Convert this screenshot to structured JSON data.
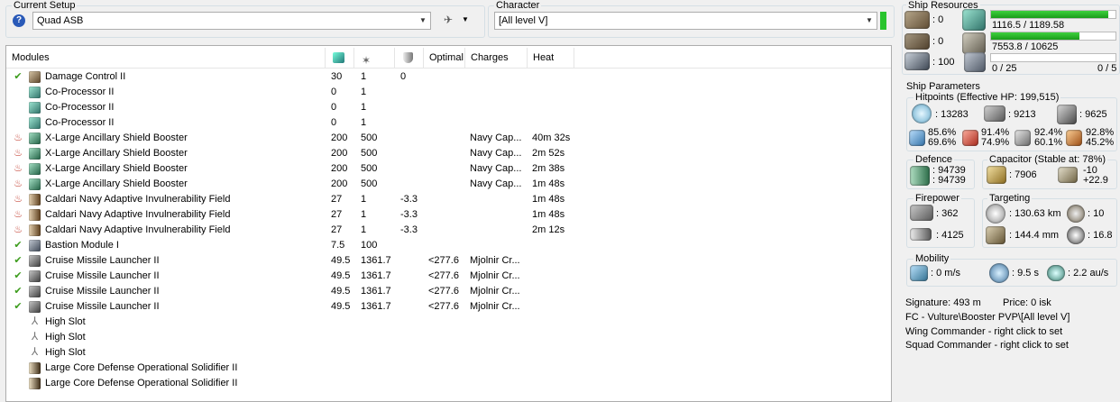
{
  "setup": {
    "group_label": "Current Setup",
    "selected": "Quad ASB"
  },
  "character": {
    "group_label": "Character",
    "selected": "[All level V]"
  },
  "modules_table": {
    "headers": {
      "modules": "Modules",
      "optimal": "Optimal",
      "charges": "Charges",
      "heat": "Heat"
    },
    "rows": [
      {
        "status": "check",
        "icon": "damage-control",
        "name": "Damage Control II",
        "cpu": "30",
        "pg": "1",
        "resist": "0",
        "optimal": "",
        "charges": "",
        "heat": ""
      },
      {
        "status": "",
        "icon": "co-processor",
        "name": "Co-Processor II",
        "cpu": "0",
        "pg": "1",
        "resist": "",
        "optimal": "",
        "charges": "",
        "heat": ""
      },
      {
        "status": "",
        "icon": "co-processor",
        "name": "Co-Processor II",
        "cpu": "0",
        "pg": "1",
        "resist": "",
        "optimal": "",
        "charges": "",
        "heat": ""
      },
      {
        "status": "",
        "icon": "co-processor",
        "name": "Co-Processor II",
        "cpu": "0",
        "pg": "1",
        "resist": "",
        "optimal": "",
        "charges": "",
        "heat": ""
      },
      {
        "status": "heat",
        "icon": "shield-booster",
        "name": "X-Large Ancillary Shield Booster",
        "cpu": "200",
        "pg": "500",
        "resist": "",
        "optimal": "",
        "charges": "Navy Cap...",
        "heat": "40m 32s"
      },
      {
        "status": "heat",
        "icon": "shield-booster",
        "name": "X-Large Ancillary Shield Booster",
        "cpu": "200",
        "pg": "500",
        "resist": "",
        "optimal": "",
        "charges": "Navy Cap...",
        "heat": "2m 52s"
      },
      {
        "status": "heat",
        "icon": "shield-booster",
        "name": "X-Large Ancillary Shield Booster",
        "cpu": "200",
        "pg": "500",
        "resist": "",
        "optimal": "",
        "charges": "Navy Cap...",
        "heat": "2m 38s"
      },
      {
        "status": "heat",
        "icon": "shield-booster",
        "name": "X-Large Ancillary Shield Booster",
        "cpu": "200",
        "pg": "500",
        "resist": "",
        "optimal": "",
        "charges": "Navy Cap...",
        "heat": "1m 48s"
      },
      {
        "status": "heat",
        "icon": "invulnerability-field",
        "name": "Caldari Navy Adaptive Invulnerability Field",
        "cpu": "27",
        "pg": "1",
        "resist": "-3.3",
        "optimal": "",
        "charges": "",
        "heat": "1m 48s"
      },
      {
        "status": "heat",
        "icon": "invulnerability-field",
        "name": "Caldari Navy Adaptive Invulnerability Field",
        "cpu": "27",
        "pg": "1",
        "resist": "-3.3",
        "optimal": "",
        "charges": "",
        "heat": "1m 48s"
      },
      {
        "status": "heat",
        "icon": "invulnerability-field",
        "name": "Caldari Navy Adaptive Invulnerability Field",
        "cpu": "27",
        "pg": "1",
        "resist": "-3.3",
        "optimal": "",
        "charges": "",
        "heat": "2m 12s"
      },
      {
        "status": "check",
        "icon": "bastion-module",
        "name": "Bastion Module I",
        "cpu": "7.5",
        "pg": "100",
        "resist": "",
        "optimal": "",
        "charges": "",
        "heat": ""
      },
      {
        "status": "check",
        "icon": "missile-launcher",
        "name": "Cruise Missile Launcher II",
        "cpu": "49.5",
        "pg": "1361.7",
        "resist": "",
        "optimal": "<277.6",
        "charges": "Mjolnir Cr...",
        "heat": ""
      },
      {
        "status": "check",
        "icon": "missile-launcher",
        "name": "Cruise Missile Launcher II",
        "cpu": "49.5",
        "pg": "1361.7",
        "resist": "",
        "optimal": "<277.6",
        "charges": "Mjolnir Cr...",
        "heat": ""
      },
      {
        "status": "check",
        "icon": "missile-launcher",
        "name": "Cruise Missile Launcher II",
        "cpu": "49.5",
        "pg": "1361.7",
        "resist": "",
        "optimal": "<277.6",
        "charges": "Mjolnir Cr...",
        "heat": ""
      },
      {
        "status": "check",
        "icon": "missile-launcher",
        "name": "Cruise Missile Launcher II",
        "cpu": "49.5",
        "pg": "1361.7",
        "resist": "",
        "optimal": "<277.6",
        "charges": "Mjolnir Cr...",
        "heat": ""
      },
      {
        "status": "",
        "icon": "high-slot",
        "name": "High Slot",
        "cpu": "",
        "pg": "",
        "resist": "",
        "optimal": "",
        "charges": "",
        "heat": ""
      },
      {
        "status": "",
        "icon": "high-slot",
        "name": "High Slot",
        "cpu": "",
        "pg": "",
        "resist": "",
        "optimal": "",
        "charges": "",
        "heat": ""
      },
      {
        "status": "",
        "icon": "high-slot",
        "name": "High Slot",
        "cpu": "",
        "pg": "",
        "resist": "",
        "optimal": "",
        "charges": "",
        "heat": ""
      },
      {
        "status": "",
        "icon": "rig",
        "name": "Large Core Defense Operational Solidifier II",
        "cpu": "",
        "pg": "",
        "resist": "",
        "optimal": "",
        "charges": "",
        "heat": ""
      },
      {
        "status": "",
        "icon": "rig",
        "name": "Large Core Defense Operational Solidifier II",
        "cpu": "",
        "pg": "",
        "resist": "",
        "optimal": "",
        "charges": "",
        "heat": ""
      }
    ]
  },
  "resources": {
    "title": "Ship Resources",
    "turret_slots": ": 0",
    "launcher_slots": ": 0",
    "calibration": ": 100",
    "cpu": "1116.5 / 1189.58",
    "cpu_fraction": 0.94,
    "powergrid": "7553.8 / 10625",
    "powergrid_fraction": 0.71,
    "drone_bay": "0 / 25",
    "drone_bandwidth": "0 / 5",
    "drone_fraction": 0
  },
  "params": {
    "title": "Ship Parameters",
    "hitpoints_title": "Hitpoints (Effective HP: 199,515)",
    "shield_hp": ": 13283",
    "armor_hp": ": 9213",
    "hull_hp": ": 9625",
    "em_shield": "85.6%",
    "em_armor": "69.6%",
    "thermal_shield": "91.4%",
    "thermal_armor": "74.9%",
    "kinetic_shield": "92.4%",
    "kinetic_armor": "60.1%",
    "explosive_shield": "92.8%",
    "explosive_armor": "45.2%",
    "defence_title": "Defence",
    "defence_1": ": 94739",
    "defence_2": ": 94739",
    "capacitor_title": "Capacitor (Stable at: 78%)",
    "capacitor": ": 7906",
    "cap_minus": "-10",
    "cap_plus": "+22.9",
    "firepower_title": "Firepower",
    "dps": ": 362",
    "volley": ": 4125",
    "targeting_title": "Targeting",
    "target_range": ": 130.63 km",
    "max_targets": ": 10",
    "scan_res": ": 144.4 mm",
    "sensor_strength": ": 16.8",
    "mobility_title": "Mobility",
    "speed": ": 0 m/s",
    "align": ": 9.5 s",
    "warp": ": 2.2 au/s"
  },
  "footer": {
    "signature": "Signature: 493 m",
    "price": "Price: 0 isk",
    "fleet": "FC - Vulture\\Booster PVP\\[All level V]",
    "wing": "Wing Commander - right click to set",
    "squad": "Squad Commander - right click to set"
  },
  "colors": {
    "check": "#3c9c1c",
    "heat": "#c0392b",
    "bar": "#22b022"
  }
}
